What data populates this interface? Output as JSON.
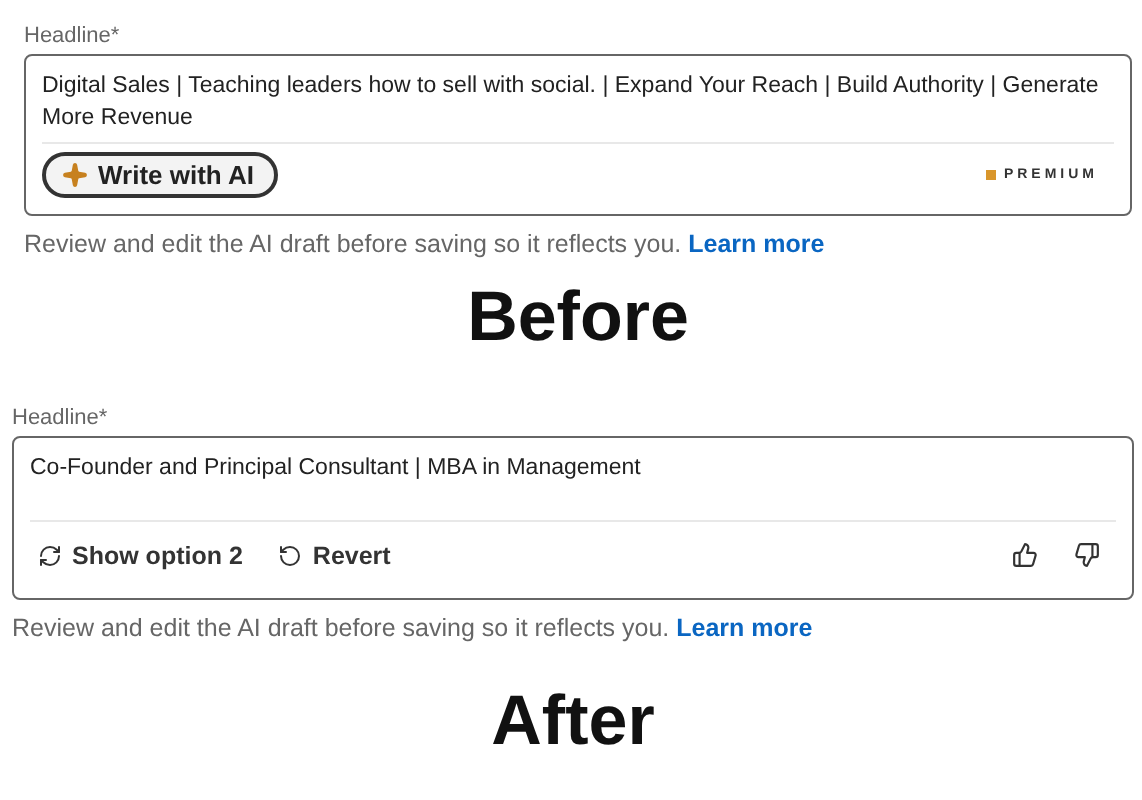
{
  "panels": [
    {
      "kind": "write",
      "label": "Headline*",
      "value": "Digital Sales | Teaching leaders how to sell with social. | Expand Your Reach | Build Authority | Generate More Revenue",
      "actions": [
        {
          "kind": "write",
          "label": "Write with AI"
        }
      ],
      "badge": "PREMIUM",
      "helper": "Review and edit the AI draft before saving so it reflects you.",
      "link": "Learn more",
      "caption": "Before"
    },
    {
      "kind": "suggestion",
      "label": "Headline*",
      "value": "Co-Founder and Principal Consultant | MBA in Management",
      "actions": [
        {
          "kind": "cycle",
          "label": "Show option 2"
        },
        {
          "kind": "revert",
          "label": "Revert"
        }
      ],
      "feedback": true,
      "helper": "Review and edit the AI draft before saving so it reflects you.",
      "link": "Learn more",
      "caption": "After"
    }
  ]
}
